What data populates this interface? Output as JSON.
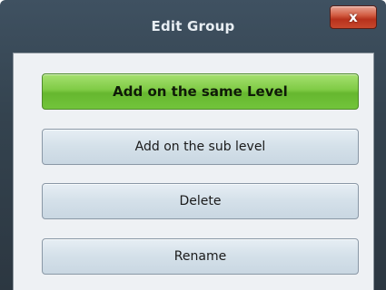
{
  "window": {
    "title": "Edit Group",
    "close_label": "x"
  },
  "buttons": {
    "add_same_level": "Add on the same Level",
    "add_sub_level": "Add on the sub level",
    "delete": "Delete",
    "rename": "Rename"
  },
  "colors": {
    "titlebar": "#34434f",
    "primary_button": "#7fcb45",
    "secondary_button": "#d4e0e9",
    "close_button": "#c7472d"
  }
}
